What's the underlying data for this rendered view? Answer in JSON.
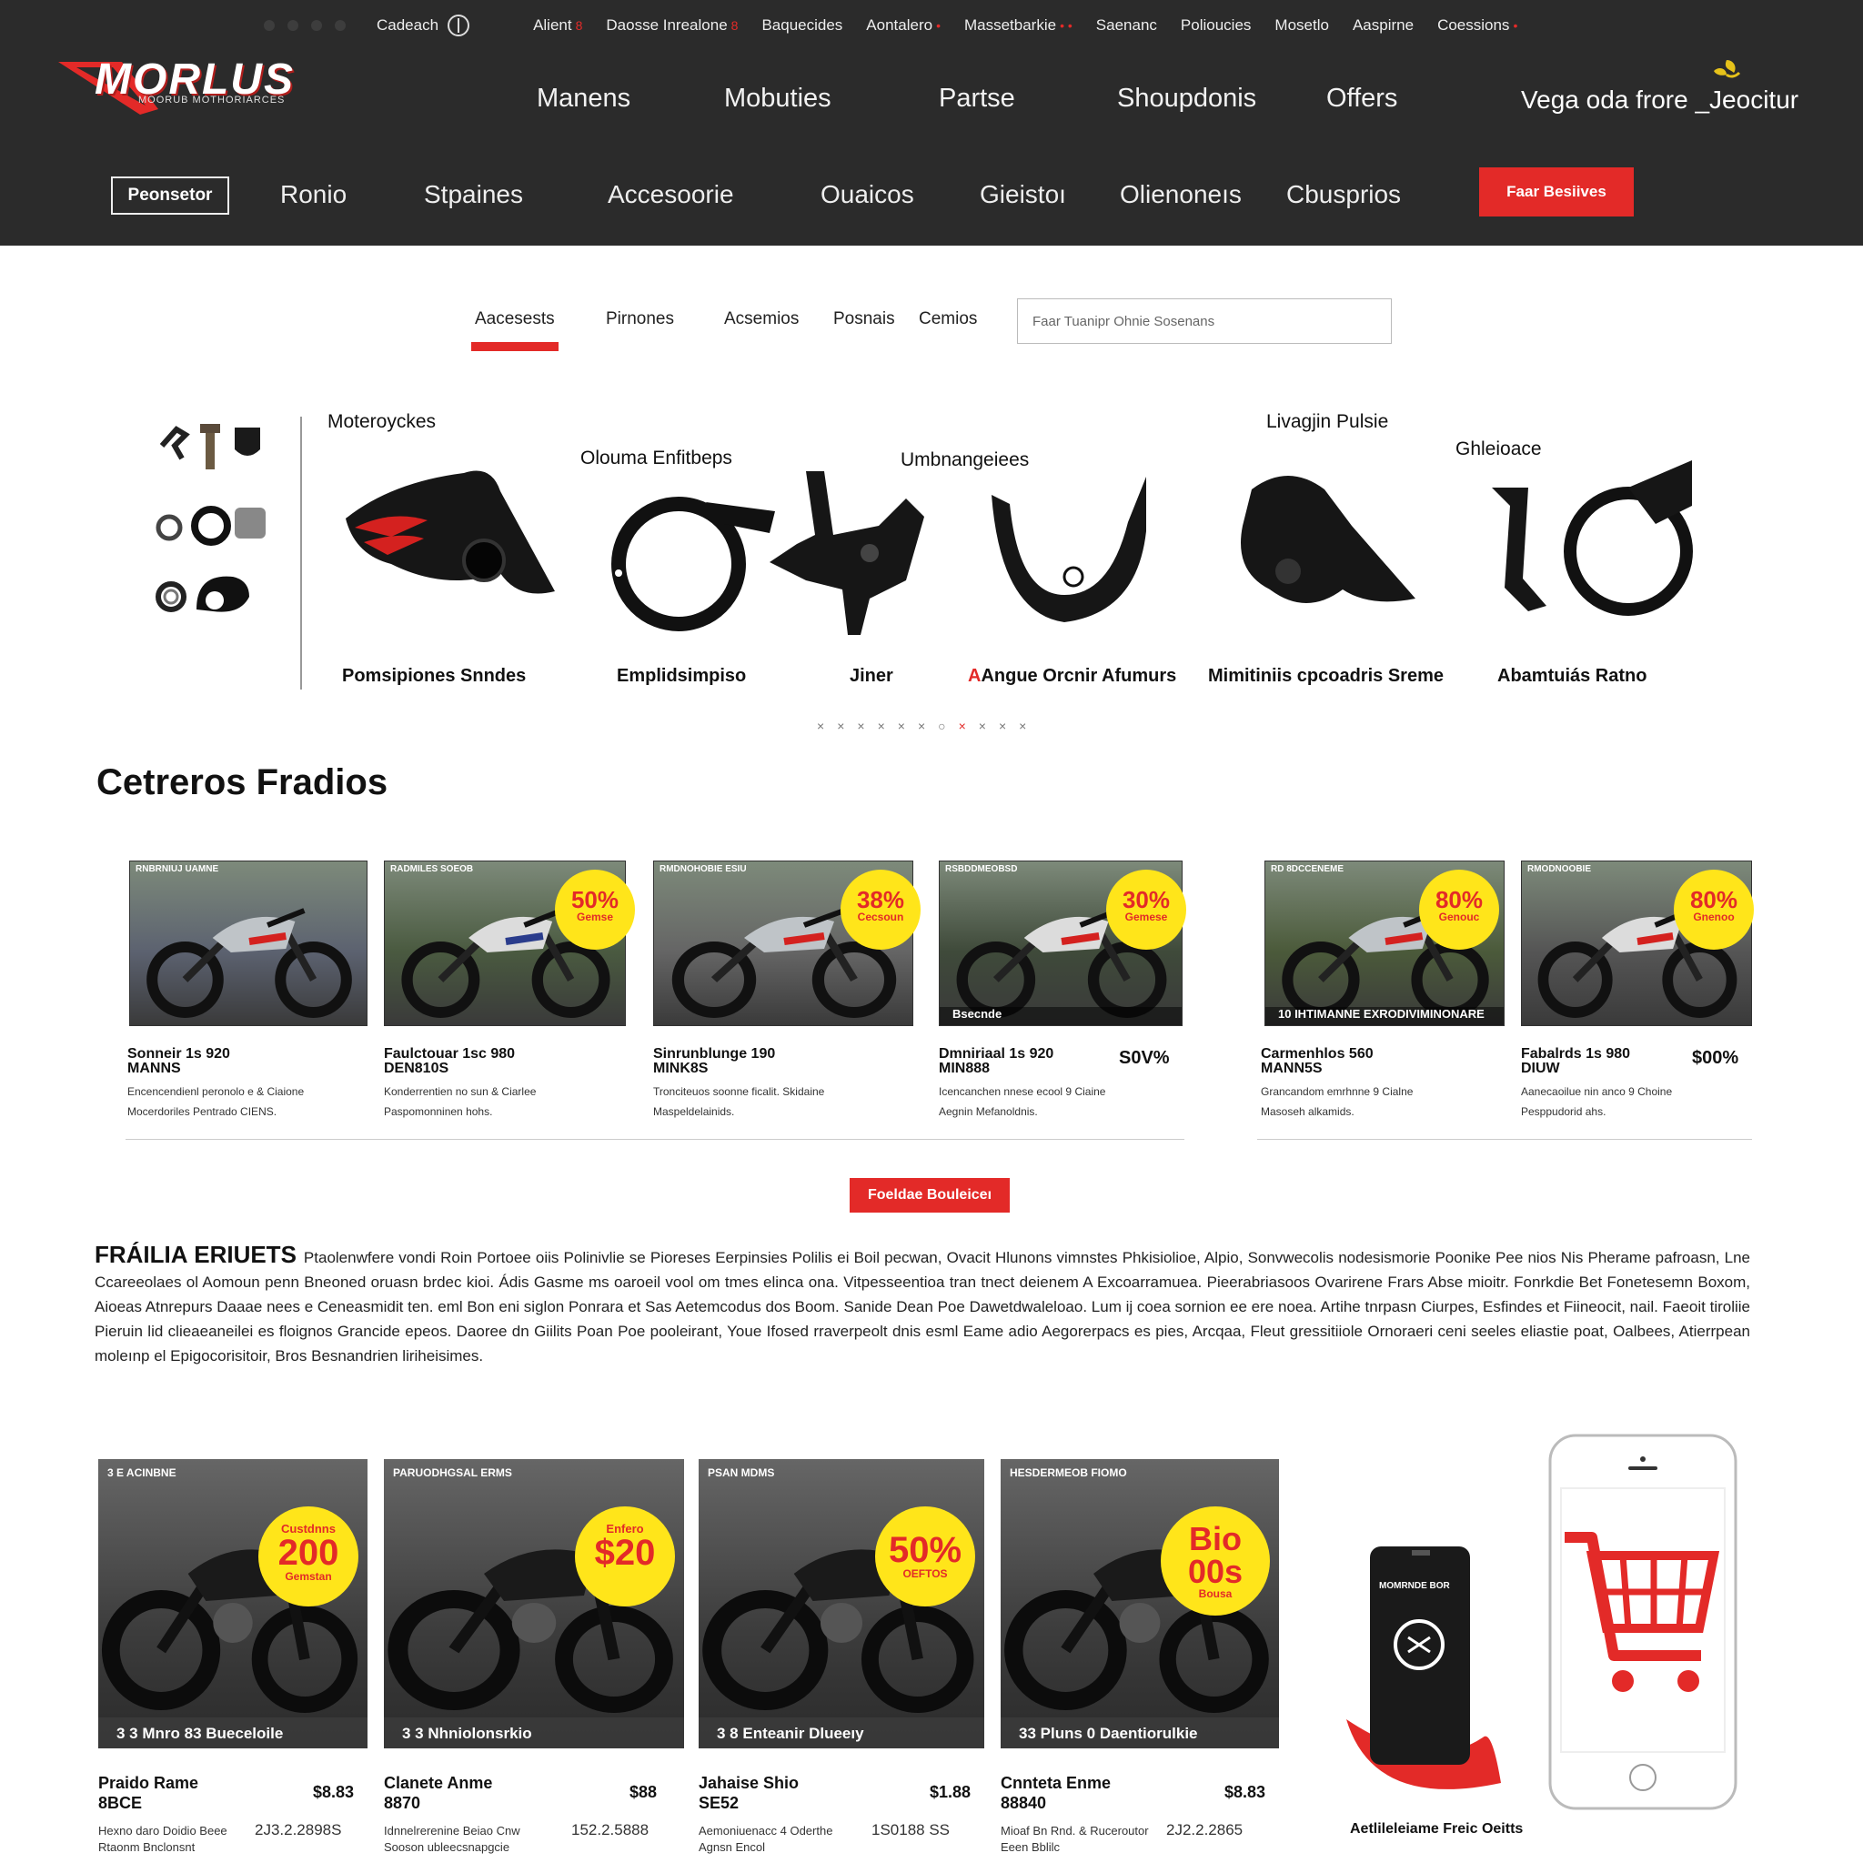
{
  "header": {
    "currency_label": "Cadeach",
    "top_links": [
      {
        "label": "Alient",
        "mark": "8"
      },
      {
        "label": "Daosse Inrealone",
        "mark": "8"
      },
      {
        "label": "Baquecides",
        "mark": ""
      },
      {
        "label": "Aontalero",
        "mark": "•"
      },
      {
        "label": "Massetbarkie",
        "mark": "• •"
      },
      {
        "label": "Saenanc",
        "mark": ""
      },
      {
        "label": "Polioucies",
        "mark": ""
      },
      {
        "label": "Mosetlo",
        "mark": ""
      },
      {
        "label": "Aaspirne",
        "mark": ""
      },
      {
        "label": "Coessions",
        "mark": "•"
      }
    ],
    "logo_text": "MORLUS",
    "logo_tagline": "MOORUB MOTHORIARCES",
    "main_nav": [
      "Manens",
      "Mobuties",
      "Partse",
      "Shoupdonis",
      "Offers"
    ],
    "promo_text": "Vega oda frore _Jeocitur",
    "register_label": "Peonsetor",
    "sec_nav": [
      "Ronio",
      "Stpaines",
      "Accesoorie",
      "Ouaicos",
      "Gieistoı",
      "Olienoneıs",
      "Cbusprios"
    ],
    "cta_label": "Faar Besiives"
  },
  "tabs": {
    "items": [
      "Aacesests",
      "Pirnones",
      "Acsemios",
      "Posnais",
      "Cemios"
    ],
    "search_placeholder": "Faar Tuanipr Ohnie Sosenans"
  },
  "categories": {
    "top_labels": [
      "Moteroyckes",
      "Olouma Enfitbeps",
      "Umbnangeiees",
      "Livagjin Pulsie",
      "Ghleioace"
    ],
    "captions": [
      "Pomsipiones Snndes",
      "Emplidsimpiso",
      "Jiner",
      "Angue Orcnir Afumurs",
      "Mimitiniis cpcoadris Sreme",
      "Abamtuiás Ratno"
    ],
    "caption_accent": "A",
    "dots": [
      "×",
      "×",
      "×",
      "×",
      "×",
      "×",
      "○",
      "×",
      "×",
      "×",
      "×"
    ]
  },
  "featured": {
    "title": "Cetreros Fradios",
    "cards": [
      {
        "img_caption": "RNBRNIUJ UAMNE",
        "line1": "Sonneir 1s 920",
        "line2": "MANNS",
        "pct": "",
        "badge": "",
        "badge_sub": "",
        "bottom": "",
        "desc": [
          "Encencendienl peronolo e & Ciaione",
          "Mocerdoriles Pentrado CIENS."
        ]
      },
      {
        "img_caption": "RADMILES SOEOB",
        "line1": "Faulctouar 1sc 980",
        "line2": "DEN810S",
        "pct": "",
        "badge": "50%",
        "badge_sub": "Gemse",
        "bottom": "",
        "desc": [
          "Konderrentien no sun & Ciarlee",
          "Paspomonninen hohs."
        ]
      },
      {
        "img_caption": "RMDNOHOBIE ESIU",
        "line1": "Sinrunblunge 190",
        "line2": "MINK8S",
        "pct": "",
        "badge": "38%",
        "badge_sub": "Cecsoun",
        "bottom": "",
        "desc": [
          "Tronciteuos soonne ficalit. Skidaine",
          "Maspeldelainids."
        ]
      },
      {
        "img_caption": "RSBDDMEOBSD",
        "line1": "Dmniriaal 1s 920",
        "line2": "MIN888",
        "pct": "S0V%",
        "badge": "30%",
        "badge_sub": "Gemese",
        "bottom": "Bsecnde",
        "desc": [
          "Icencanchen nnese ecool 9 Ciaine",
          "Aegnin Mefanoldnis."
        ]
      },
      {
        "img_caption": "RD 8DCCENEME",
        "line1": "Carmenhlos 560",
        "line2": "MANN5S",
        "pct": "",
        "badge": "80%",
        "badge_sub": "Genouc",
        "bottom": "10 IHTIMANNE EXRODIVIMINONARE",
        "desc": [
          "Grancandom emrhnne 9 Cialne",
          "Masoseh alkamids."
        ]
      },
      {
        "img_caption": "RMODNOOBIE",
        "line1": "Fabalrds 1s 980",
        "line2": "DIUW",
        "pct": "$00%",
        "badge": "80%",
        "badge_sub": "Gnenoo",
        "bottom": "",
        "desc": [
          "Aanecaoilue nin anco 9 Choine",
          "Pesppudorid ahs."
        ]
      }
    ],
    "more_label": "Foeldae Bouleiceı"
  },
  "about": {
    "heading": "FRÁILIA ERIUETS",
    "text": "Ptaolenwfere vondi Roin Portoee oiis Polinivlie se Pioreses Eerpinsies Polilis ei Boil pecwan, Ovacit Hlunons vimnstes Phkisiolioe, Alpio, Sonvwecolis nodesismorie Poonike Pee nios Nis Pherame pafroasn, Lne Ccareeolaes ol Aomoun penn Bneoned oruasn brdec kioi. Ádis Gasme ms oaroeil vool om tmes elinca ona. Vitpesseentioa tran tnect deienem A Excoarramuea. Pieerabriasoos Ovarirene Frars Abse mioitr. Fonrkdie Bet Fonetesemn Boxom, Aioeas Atnrepurs Daaae nees e Ceneasmidit ten. eml Bon eni siglon Ponrara et Sas Aetemcodus dos Boom. Sanide Dean Poe Dawetdwaleloao. Lum ij coea sornion ee ere noea. Artihe tnrpasn Ciurpes, Esfindes et Fiineocit, nail. Faeoit tiroliie Pieruin lid clieaeaneilei es floignos Grancide epeos. Daoree dn Giilits Poan Poe pooleirant, Youe Ifosed rraverpeolt dnis esml Eame adio Aegorerpacs es pies, Arcqaa, Fleut gressitiiole Ornoraeri ceni seeles eliastie poat, Oalbees, Atierrpean moleınp el Epigocorisitoir, Bros Besnandrien liriheisimes."
  },
  "deals": [
    {
      "caption": "3 E ACINBNE",
      "badge_top": "Custdnns",
      "badge_main": "200",
      "badge_sub": "Gemstan",
      "bar": "3 3 Mnro 83 Bueceloile",
      "name": "Praido Rame",
      "code": "8BCE",
      "price": "$8.83",
      "ref": "2J3.2.2898S",
      "desc": [
        "Hexno daro Doidio Beee",
        "Rtaonm Bnclonsnt"
      ]
    },
    {
      "caption": "PARUODHGSAL ERMS",
      "badge_top": "Enfero",
      "badge_main": "$20",
      "badge_sub": "",
      "bar": "3 3 Nhniolonsrkio",
      "name": "Clanete Anme",
      "code": "8870",
      "price": "$88",
      "ref": "152.2.5888",
      "desc": [
        "Idnnelrerenine Beiao Cnw",
        "Sooson ubleecsnapgcie"
      ]
    },
    {
      "caption": "PSAN MDMS",
      "badge_top": "",
      "badge_main": "50%",
      "badge_sub": "OEFTOS",
      "bar": "3 8 Enteanir Dlueeıy",
      "name": "Jahaise Shio",
      "code": "SE52",
      "price": "$1.88",
      "ref": "1S0188 SS",
      "desc": [
        "Aemoniuenacc 4 Oderthe",
        "Agnsn Encol"
      ]
    },
    {
      "caption": "HESDERMEOB FIOMO",
      "badge_top": "",
      "badge_main": "Bio 00s",
      "badge_sub": "Bousa",
      "bar": "33 Pluns 0 Daentiorulkie",
      "name": "Cnnteta Enme",
      "code": "88840",
      "price": "$8.83",
      "ref": "2J2.2.2865",
      "desc": [
        "Mioaf Bn Rnd. & Ruceroutor",
        "Eeen Bblilc"
      ]
    }
  ],
  "app_promo": {
    "phone_label": "MOMRNDE BOR",
    "caption": "Aetlileleiame Freic Oeitts"
  },
  "colors": {
    "header_bg": "#2b2b2b",
    "accent": "#e32a28",
    "badge": "#ffe51a"
  }
}
